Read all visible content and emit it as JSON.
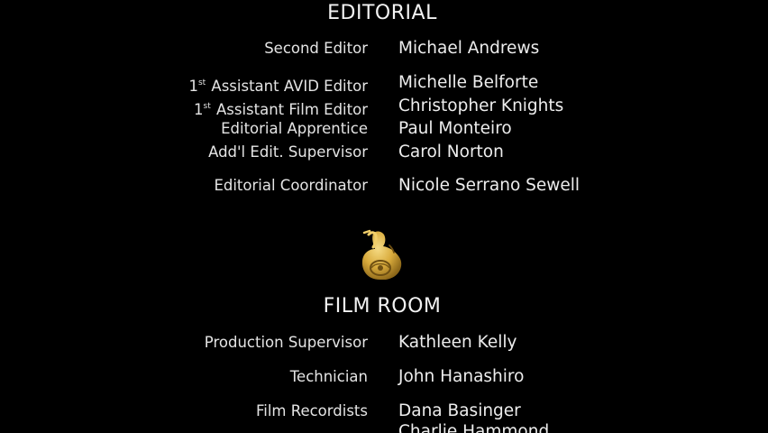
{
  "sections": [
    {
      "heading": "EDITORIAL",
      "credits": [
        {
          "role": "Second Editor",
          "name": "Michael Andrews"
        },
        {
          "role_prefix": "1",
          "role_sup": "st",
          "role": "Assistant AVID Editor",
          "name": "Michelle Belforte"
        },
        {
          "role_prefix": "1",
          "role_sup": "st",
          "role": "Assistant Film Editor",
          "name": "Christopher Knights"
        },
        {
          "role": "Editorial Apprentice",
          "name": "Paul Monteiro"
        },
        {
          "role": "Add'l Edit. Supervisor",
          "name": "Carol Norton"
        },
        {
          "role": "Editorial Coordinator",
          "name": "Nicole Serrano Sewell"
        }
      ]
    },
    {
      "heading": "FILM ROOM",
      "credits": [
        {
          "role": "Production Supervisor",
          "name": "Kathleen Kelly"
        },
        {
          "role": "Technician",
          "name": "John Hanashiro"
        },
        {
          "role": "Film Recordists",
          "name": "Dana Basinger"
        },
        {
          "role": "",
          "name": "Charlie Hammond"
        }
      ]
    }
  ],
  "emblem": {
    "icon": "gold-seal-emblem-icon",
    "color_light": "#e8c25a",
    "color_dark": "#8a6518"
  }
}
